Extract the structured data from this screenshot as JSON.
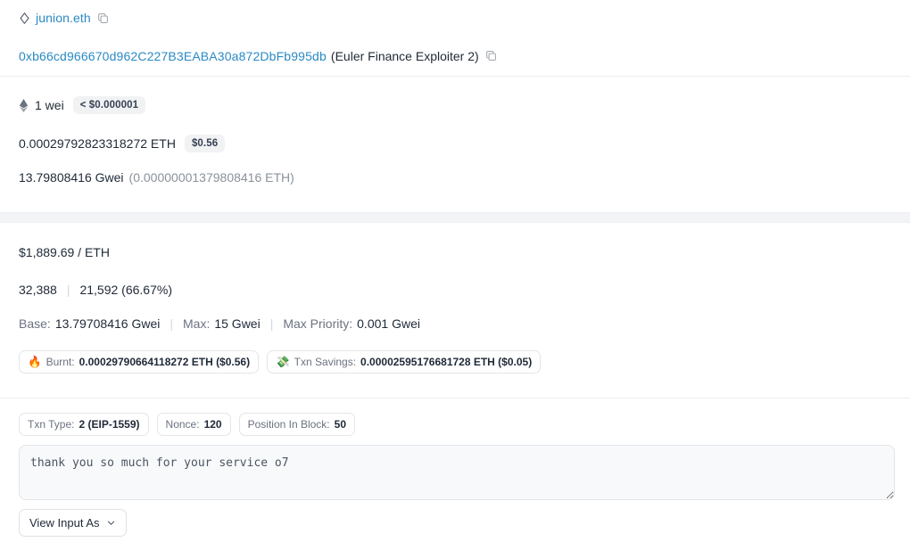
{
  "ens": {
    "name": "junion.eth",
    "ens_icon": "ens-diamond-icon",
    "copy_icon": "copy-icon"
  },
  "address_row": {
    "address": "0xb66cd966670d962C227B3EABA30a872DbFb995db",
    "label": "(Euler Finance Exploiter 2)",
    "copy_icon": "copy-icon"
  },
  "value_row": {
    "eth_icon": "ethereum-diamond-icon",
    "amount": "1 wei",
    "usd_badge": "< $0.000001"
  },
  "fee_row": {
    "amount": "0.00029792823318272 ETH",
    "usd_badge": "$0.56"
  },
  "gas_price_row": {
    "gwei": "13.79808416 Gwei",
    "eth": "(0.00000001379808416 ETH)"
  },
  "eth_price": {
    "text": "$1,889.69 / ETH"
  },
  "gas_usage": {
    "limit": "32,388",
    "separator": "|",
    "used": "21,592 (66.67%)"
  },
  "gas_fees": {
    "base_label": "Base:",
    "base_value": "13.79708416 Gwei",
    "sep1": "|",
    "max_label": "Max:",
    "max_value": "15 Gwei",
    "sep2": "|",
    "priority_label": "Max Priority:",
    "priority_value": "0.001 Gwei"
  },
  "burnt_savings": [
    {
      "emoji": "🔥",
      "icon_name": "fire-icon",
      "label": "Burnt:",
      "value": "0.00029790664118272 ETH ($0.56)"
    },
    {
      "emoji": "💸",
      "icon_name": "money-with-wings-icon",
      "label": "Txn Savings:",
      "value": "0.00002595176681728 ETH ($0.05)"
    }
  ],
  "meta_pills": [
    {
      "label": "Txn Type:",
      "value": "2 (EIP-1559)"
    },
    {
      "label": "Nonce:",
      "value": "120"
    },
    {
      "label": "Position In Block:",
      "value": "50"
    }
  ],
  "input_data": {
    "value": "thank you so much for your service o7",
    "placeholder": ""
  },
  "view_input_button": {
    "label": "View Input As",
    "chevron_icon": "chevron-down-icon"
  },
  "colors": {
    "link": "#2a8ac4",
    "text": "#1f2937",
    "muted": "#8a929b",
    "divider": "#eceef1",
    "band": "#f2f4f6",
    "badge_bg": "#f1f2f4",
    "input_bg": "#f8f9fa"
  }
}
